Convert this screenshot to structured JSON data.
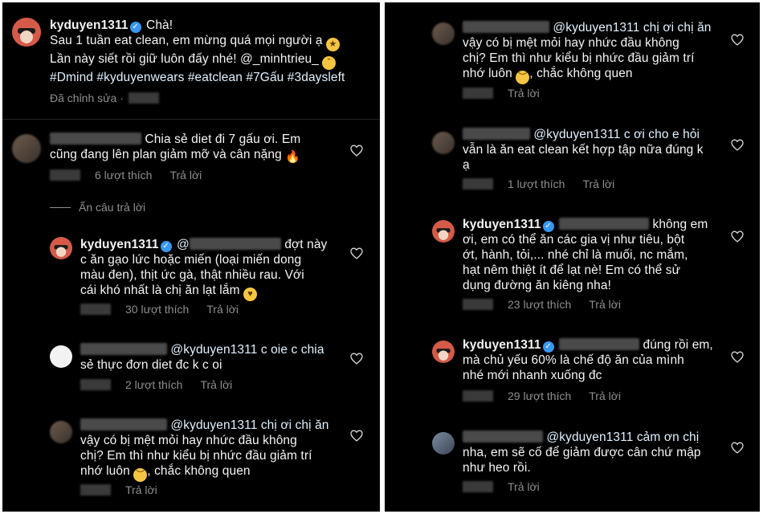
{
  "caption": {
    "username": "kyduyen1311",
    "line1_after": "Chà!",
    "line2": "Sau 1 tuần eat clean, em mừng quá mọi người ạ",
    "line3_pre": "Lần này siết rồi giữ luôn đấy nhé! @_minhtrieu_",
    "line4": "#Dmind #kyduyenwears #eatclean #7Gấu #3daysleft",
    "edited": "Đã chỉnh sửa ·"
  },
  "left": {
    "c1": {
      "line1": "Chia sẻ diet đi 7 gấu ơi. Em",
      "line2": "cũng đang lên plan giảm mỡ và cân nặng",
      "likes": "6 lượt thích",
      "reply": "Trả lời"
    },
    "hide_replies": "Ẩn câu trả lời",
    "r1": {
      "username": "kyduyen1311",
      "line1_after": "đợt này",
      "line2": "c ăn gạo lức hoặc miến (loại miến dong",
      "line3": "màu đen), thịt ức gà, thật nhiều rau. Với",
      "line4": "cái khó nhất là chị ăn lạt lắm",
      "likes": "30 lượt thích",
      "reply": "Trả lời"
    },
    "r2": {
      "line1_mention": "@kyduyen1311 c oie c chia",
      "line2": "sẻ thực đơn diet đc k c oi",
      "likes": "2 lượt thích",
      "reply": "Trả lời"
    },
    "r3": {
      "line1_mention": "@kyduyen1311 chị ơi chị ăn",
      "line2": "vậy có bị mệt mỏi hay nhức đầu không",
      "line3": "chị? Em thì như kiểu bị nhức đầu giảm trí",
      "line4": "nhớ luôn",
      "line4_after": ", chắc không quen",
      "reply": "Trả lời"
    }
  },
  "right": {
    "r3": {
      "line1_mention": "@kyduyen1311 chị ơi chị ăn",
      "line2": "vậy có bị mệt mỏi hay nhức đầu không",
      "line3": "chị? Em thì như kiểu bị nhức đầu giảm trí",
      "line4": "nhớ luôn",
      "line4_after": ", chắc không quen",
      "reply": "Trả lời"
    },
    "r4": {
      "line1_mention": "@kyduyen1311 c ơi cho e hỏi",
      "line2": "vẫn là ăn eat clean kết hợp tập nữa đúng k",
      "line3": "ạ",
      "likes": "1 lượt thích",
      "reply": "Trả lời"
    },
    "r5": {
      "username": "kyduyen1311",
      "line1_after": "không em",
      "line2": "ơi, em có thể ăn các gia vị như tiêu, bột",
      "line3": "ớt, hành, tỏi,... nhé chỉ là muối, nc mắm,",
      "line4": "hạt nêm thiệt ít để lạt nè! Em có thể sử",
      "line5": "dụng đường ăn kiêng nha!",
      "likes": "23 lượt thích",
      "reply": "Trả lời"
    },
    "r6": {
      "username": "kyduyen1311",
      "line1_after": "đúng rồi em,",
      "line2": "mà chủ yếu 60% là chế độ ăn của mình",
      "line3": "nhé mới nhanh xuống đc",
      "likes": "29 lượt thích",
      "reply": "Trả lời"
    },
    "r7": {
      "line1_mention": "@kyduyen1311 cảm ơn chị",
      "line2": "nha, em sẽ cố để giảm được cân chứ mập",
      "line3": "như heo rồi.",
      "reply": "Trả lời"
    }
  },
  "colors": {
    "background": "#000000",
    "text": "#f5f5f5",
    "meta": "#8e8e8e",
    "verified": "#3897f0",
    "mention": "#e0f1ff"
  },
  "icons": {
    "heart": "heart-outline-icon",
    "verified": "verified-badge-icon"
  }
}
